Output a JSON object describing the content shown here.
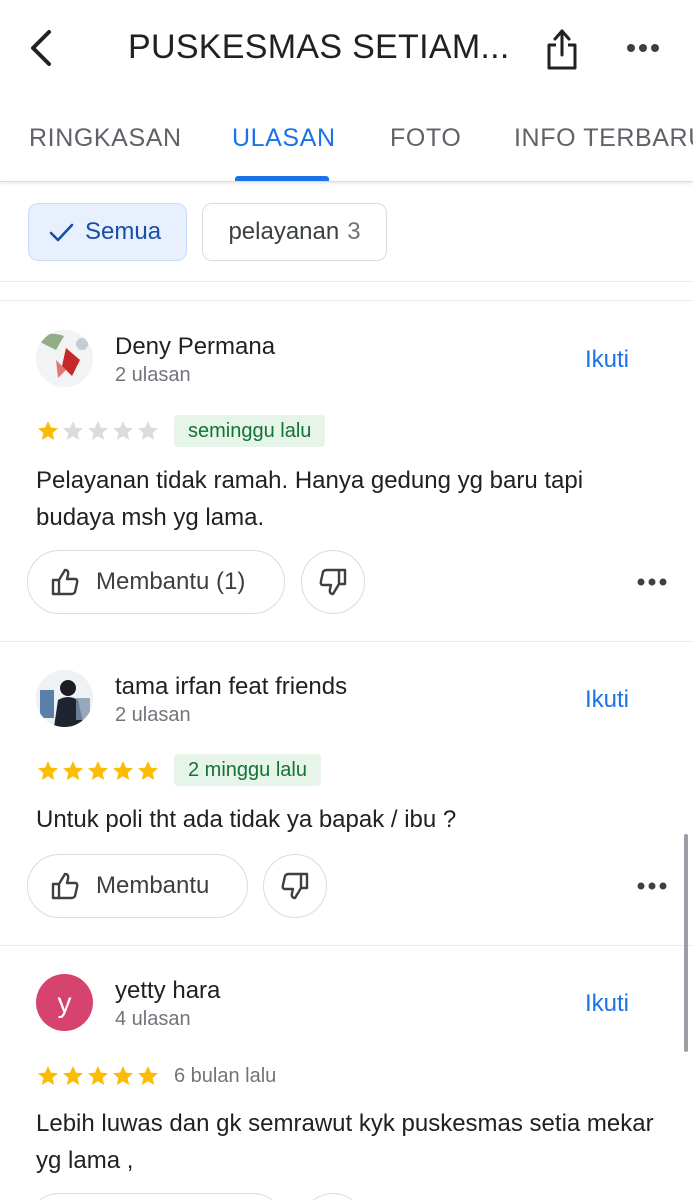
{
  "header": {
    "title": "PUSKESMAS SETIAM...",
    "back_icon": "chevron-left-icon",
    "share_icon": "share-icon",
    "more_icon": "more-horizontal-icon"
  },
  "tabs": [
    {
      "label": "RINGKASAN",
      "active": false
    },
    {
      "label": "ULASAN",
      "active": true
    },
    {
      "label": "FOTO",
      "active": false
    },
    {
      "label": "INFO TERBARU",
      "active": false
    }
  ],
  "filters": {
    "all_label": "Semua",
    "tag_label": "pelayanan",
    "tag_count": "3"
  },
  "colors": {
    "accent": "#1a73e8",
    "star": "#fbbc04",
    "badge_green_bg": "#e6f4ea",
    "badge_green_text": "#137333"
  },
  "reviews": [
    {
      "name": "Deny Permana",
      "review_count": "2 ulasan",
      "follow_label": "Ikuti",
      "rating": 1,
      "time": "seminggu lalu",
      "text": "Pelayanan tidak ramah. Hanya gedung yg baru tapi budaya msh yg lama.",
      "helpful_label": "Membantu (1)"
    },
    {
      "name": "tama irfan feat friends",
      "review_count": "2 ulasan",
      "follow_label": "Ikuti",
      "rating": 5,
      "time": "2 minggu lalu",
      "text": "Untuk poli tht ada tidak ya bapak / ibu ?",
      "helpful_label": "Membantu"
    },
    {
      "name": "yetty hara",
      "avatar_letter": "y",
      "avatar_color": "#d6436e",
      "review_count": "4 ulasan",
      "follow_label": "Ikuti",
      "rating": 5,
      "time": "6 bulan lalu",
      "text": "Lebih luwas dan gk semrawut kyk puskesmas setia mekar yg lama ,"
    }
  ]
}
